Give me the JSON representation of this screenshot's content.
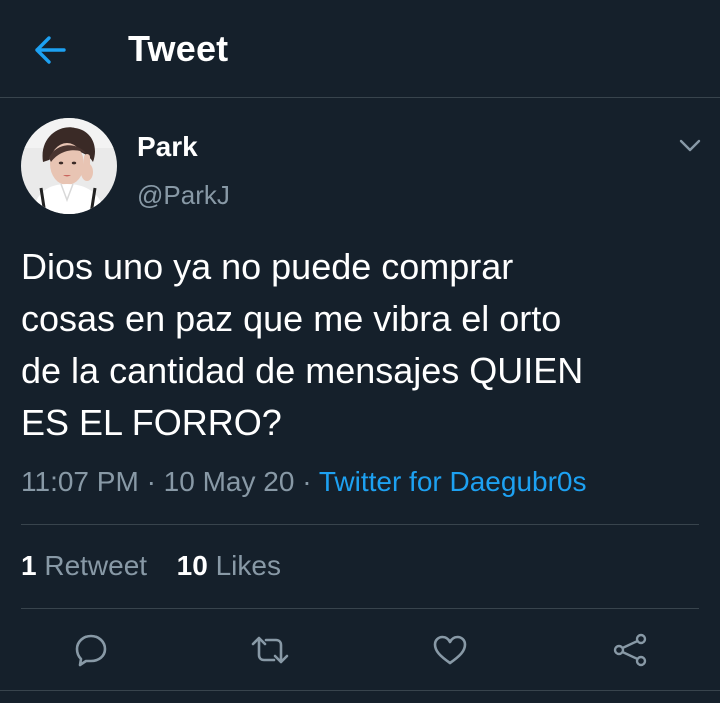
{
  "header": {
    "title": "Tweet",
    "back_icon": "arrow-left-icon"
  },
  "author": {
    "display_name": "Park",
    "handle": "@ParkJ",
    "avatar_icon": "user-avatar"
  },
  "tweet": {
    "text": "Dios uno ya no puede comprar\ncosas en paz que me vibra el orto\nde la cantidad de mensajes QUIEN\nES EL FORRO?",
    "time": "11:07 PM",
    "separator": "·",
    "date": "10 May 20",
    "source": "Twitter for Daegubr0s"
  },
  "stats": {
    "retweets_count": "1",
    "retweets_label": "Retweet",
    "likes_count": "10",
    "likes_label": "Likes"
  },
  "actions": [
    "reply-icon",
    "retweet-icon",
    "like-icon",
    "share-icon"
  ],
  "colors": {
    "background": "#15202b",
    "accent": "#1da1f2",
    "secondary_text": "#8899a6",
    "divider": "#38444d"
  }
}
